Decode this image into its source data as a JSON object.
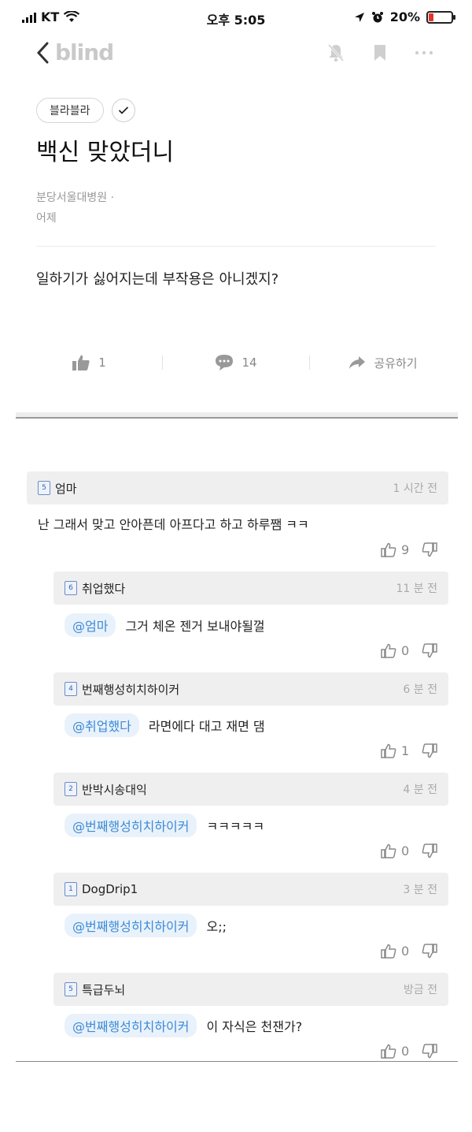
{
  "status_bar": {
    "carrier": "KT",
    "time": "오후 5:05",
    "battery": "20%",
    "battery_level": 0.2
  },
  "nav": {
    "brand": "blind"
  },
  "post": {
    "category": "블라블라",
    "title": "백신 맞았더니",
    "author": "분당서울대병원 ·",
    "date": "어제",
    "body": "일하기가 싫어지는데 부작용은 아니겠지?",
    "likes": "1",
    "comments": "14",
    "share_label": "공유하기"
  },
  "comments": [
    {
      "badge": "5",
      "name": "엄마",
      "time": "1 시간 전",
      "mention": "",
      "text": "난 그래서 맞고 안아픈데 아프다고 하고 하루쨈 ㅋㅋ",
      "likes": "9"
    },
    {
      "badge": "6",
      "name": "취업했다",
      "time": "11 분 전",
      "mention": "@엄마",
      "text": "그거 체온 젠거 보내야될껄",
      "likes": "0"
    },
    {
      "badge": "4",
      "name": "번째행성히치하이커",
      "time": "6 분 전",
      "mention": "@취업했다",
      "text": "라면에다 대고 재면 댐",
      "likes": "1"
    },
    {
      "badge": "2",
      "name": "반박시송대익",
      "time": "4 분 전",
      "mention": "@번째행성히치하이커",
      "text": "ㅋㅋㅋㅋㅋ",
      "likes": "0"
    },
    {
      "badge": "1",
      "name": "DogDrip1",
      "time": "3 분 전",
      "mention": "@번째행성히치하이커",
      "text": "오;;",
      "likes": "0"
    },
    {
      "badge": "5",
      "name": "특급두뇌",
      "time": "방금 전",
      "mention": "@번째행성히치하이커",
      "text": "이 자식은 천잰가?",
      "likes": "0"
    }
  ]
}
